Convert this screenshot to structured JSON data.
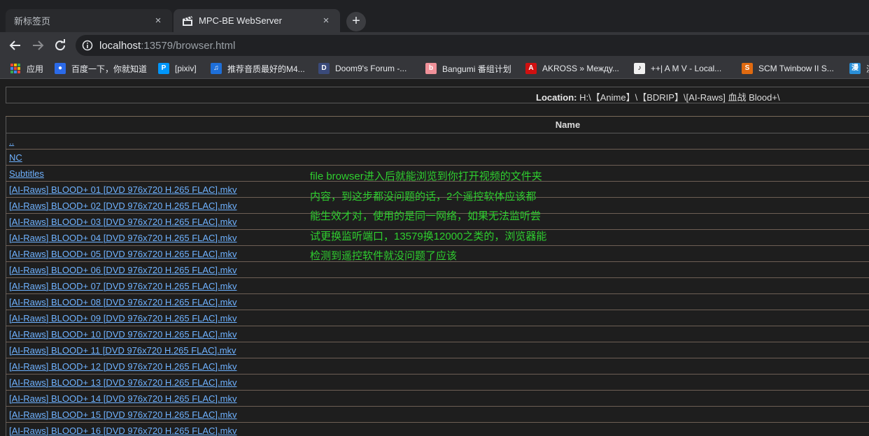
{
  "tabs": [
    {
      "title": "新标签页",
      "close": "×"
    },
    {
      "title": "MPC-BE WebServer",
      "close": "×"
    }
  ],
  "newtab_symbol": "+",
  "address": {
    "host": "localhost",
    "rest": ":13579/browser.html"
  },
  "bookmarks": [
    {
      "label": "应用",
      "icon": "apps-grid-icon"
    },
    {
      "label": "百度一下，你就知道",
      "icon": "baidu-paw-icon"
    },
    {
      "label": "[pixiv]",
      "icon": "pixiv-icon"
    },
    {
      "label": "推荐音质最好的M4...",
      "icon": "music-icon"
    },
    {
      "label": "Doom9's Forum -...",
      "icon": "doom9-icon"
    },
    {
      "label": "Bangumi 番组计划",
      "icon": "bangumi-icon"
    },
    {
      "label": "AKROSS » Между...",
      "icon": "akross-icon"
    },
    {
      "label": "++| A M V - Local...",
      "icon": "amv-icon"
    },
    {
      "label": "SCM Twinbow II S...",
      "icon": "scm-icon"
    },
    {
      "label": "漫",
      "icon": "manga-icon"
    }
  ],
  "location": {
    "label": "Location:",
    "path": "H:\\【Anime】\\【BDRIP】\\[AI-Raws] 血战 Blood+\\"
  },
  "table": {
    "header": "Name",
    "rows": [
      "..",
      "NC",
      "Subtitles",
      "[AI-Raws] BLOOD+ 01 [DVD 976x720 H.265 FLAC].mkv",
      "[AI-Raws] BLOOD+ 02 [DVD 976x720 H.265 FLAC].mkv",
      "[AI-Raws] BLOOD+ 03 [DVD 976x720 H.265 FLAC].mkv",
      "[AI-Raws] BLOOD+ 04 [DVD 976x720 H.265 FLAC].mkv",
      "[AI-Raws] BLOOD+ 05 [DVD 976x720 H.265 FLAC].mkv",
      "[AI-Raws] BLOOD+ 06 [DVD 976x720 H.265 FLAC].mkv",
      "[AI-Raws] BLOOD+ 07 [DVD 976x720 H.265 FLAC].mkv",
      "[AI-Raws] BLOOD+ 08 [DVD 976x720 H.265 FLAC].mkv",
      "[AI-Raws] BLOOD+ 09 [DVD 976x720 H.265 FLAC].mkv",
      "[AI-Raws] BLOOD+ 10 [DVD 976x720 H.265 FLAC].mkv",
      "[AI-Raws] BLOOD+ 11 [DVD 976x720 H.265 FLAC].mkv",
      "[AI-Raws] BLOOD+ 12 [DVD 976x720 H.265 FLAC].mkv",
      "[AI-Raws] BLOOD+ 13 [DVD 976x720 H.265 FLAC].mkv",
      "[AI-Raws] BLOOD+ 14 [DVD 976x720 H.265 FLAC].mkv",
      "[AI-Raws] BLOOD+ 15 [DVD 976x720 H.265 FLAC].mkv",
      "[AI-Raws] BLOOD+ 16 [DVD 976x720 H.265 FLAC].mkv"
    ]
  },
  "annotation_lines": [
    "file browser进入后就能浏览到你打开视频的文件夹",
    "内容，到这步都没问题的话，2个遥控软体应该都",
    "能生效才对，使用的是同一网络，如果无法监听尝",
    "试更换监听端口，13579换12000之类的，浏览器能",
    "检测到遥控软件就没问题了应该"
  ],
  "colors": {
    "link": "#6fb2ff",
    "annotation": "#2fcf2f"
  }
}
